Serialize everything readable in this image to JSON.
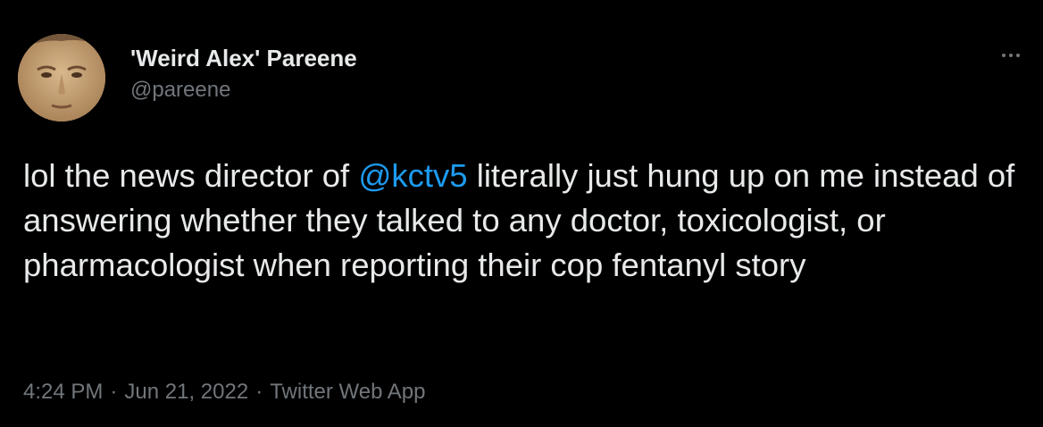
{
  "tweet": {
    "author": {
      "display_name": "'Weird Alex' Pareene",
      "handle": "@pareene",
      "avatar_icon": "profile-photo"
    },
    "more_icon": "more-horizontal-icon",
    "text": {
      "before_mention": "lol the news director of ",
      "mention": "@kctv5",
      "after_mention": " literally just hung up on me instead of answering whether they talked to any doctor, toxicologist, or pharmacologist when reporting their cop fentanyl story"
    },
    "meta": {
      "time": "4:24 PM",
      "separator": "·",
      "date": "Jun 21, 2022",
      "source": "Twitter Web App"
    },
    "colors": {
      "background": "#000000",
      "text": "#e7e9ea",
      "secondary": "#71767b",
      "link": "#1d9bf0"
    }
  }
}
